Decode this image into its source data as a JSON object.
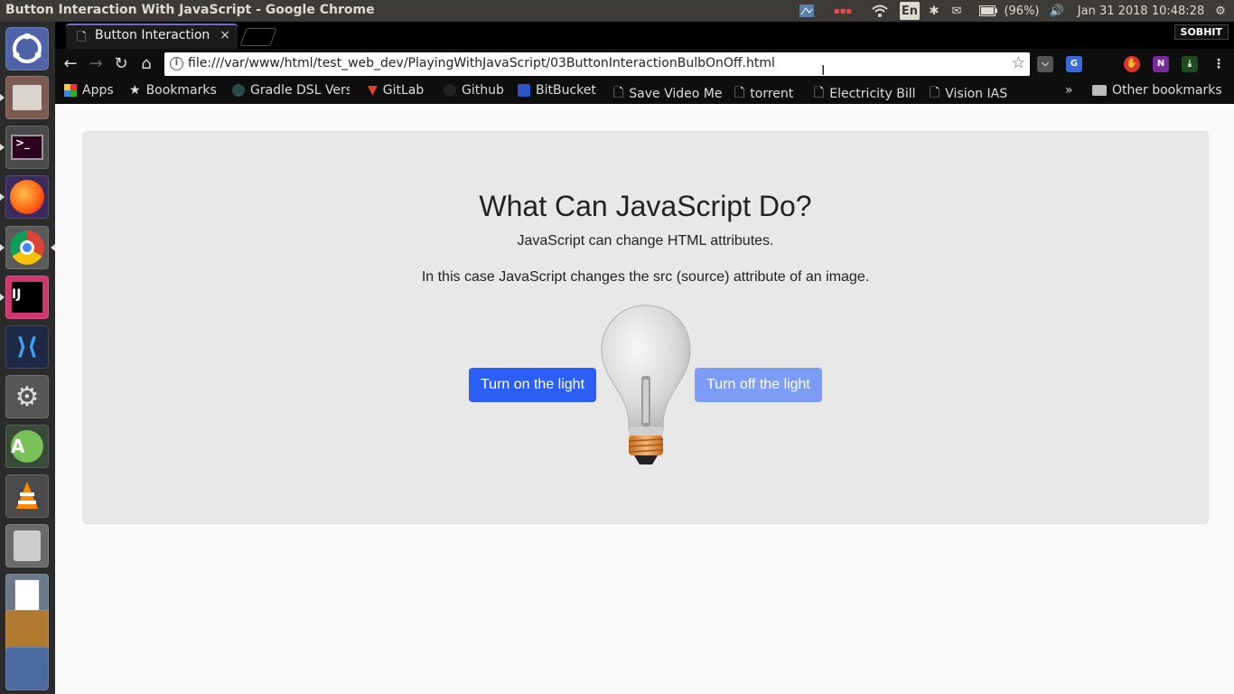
{
  "system": {
    "window_title": "Button Interaction With JavaScript - Google Chrome",
    "keyboard": "En",
    "battery": "(96%)",
    "datetime": "Jan 31 2018 10:48:28"
  },
  "launcher": {
    "icons": [
      "ubuntu-dash-icon",
      "files-icon",
      "terminal-icon",
      "firefox-icon",
      "chrome-icon",
      "intellij-icon",
      "vscode-icon",
      "system-settings-icon",
      "android-studio-icon",
      "vlc-icon",
      "installer-icon",
      "document-viewer-icon",
      "desktop-icon",
      "workspaces-icon"
    ]
  },
  "chrome": {
    "tab_title": "Button Interaction",
    "tab_close": "×",
    "profile": "SOBHIT",
    "url": "file:///var/www/html/test_web_dev/PlayingWithJavaScript/03ButtonInteractionBulbOnOff.html",
    "bookmarks": [
      "Apps",
      "Bookmarks",
      "Gradle DSL Vers",
      "GitLab",
      "Github",
      "BitBucket",
      "Save Video Me",
      "torrent",
      "Electricity Bill",
      "Vision IAS"
    ],
    "overflow": "»",
    "other_bookmarks": "Other bookmarks"
  },
  "page": {
    "heading": "What Can JavaScript Do?",
    "paragraph1": "JavaScript can change HTML attributes.",
    "paragraph2": "In this case JavaScript changes the src (source) attribute of an image.",
    "btn_on": "Turn on the light",
    "btn_off": "Turn off the light"
  },
  "colors": {
    "primary_button": "#2b5ff5",
    "disabled_button": "#7c9cf6",
    "jumbotron_bg": "#e8e8e8"
  }
}
